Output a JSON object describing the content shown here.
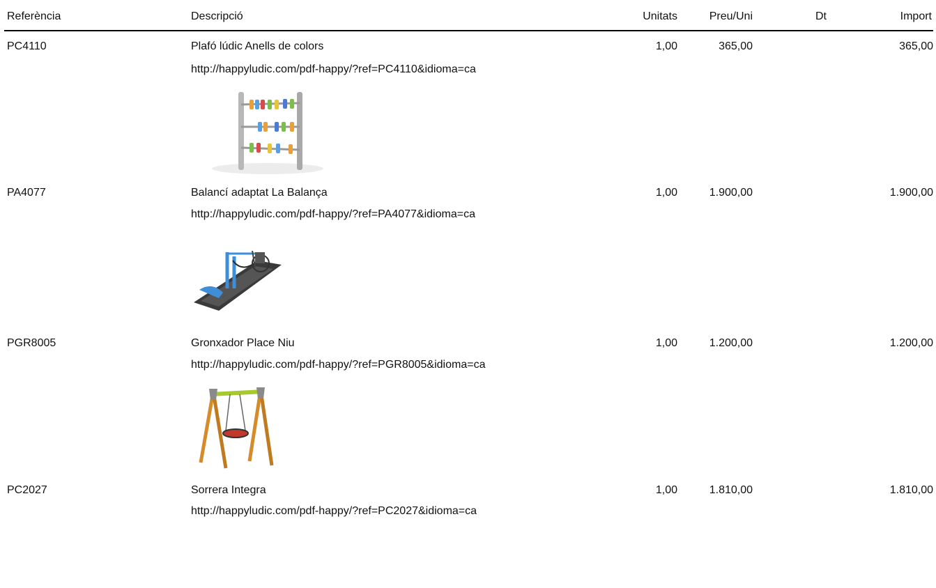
{
  "headers": {
    "reference": "Referència",
    "description": "Descripció",
    "units": "Unitats",
    "unit_price": "Preu/Uni",
    "discount": "Dt",
    "amount": "Import"
  },
  "rows": [
    {
      "reference": "PC4110",
      "description": "Plafó lúdic Anells de colors",
      "url": "http://happyludic.com/pdf-happy/?ref=PC4110&idioma=ca",
      "units": "1,00",
      "unit_price": "365,00",
      "discount": "",
      "amount": "365,00",
      "image": "abacus-rings-panel-image"
    },
    {
      "reference": "PA4077",
      "description": "Balancí adaptat La Balança",
      "url": "http://happyludic.com/pdf-happy/?ref=PA4077&idioma=ca",
      "units": "1,00",
      "unit_price": "1.900,00",
      "discount": "",
      "amount": "1.900,00",
      "image": "wheelchair-seesaw-image"
    },
    {
      "reference": "PGR8005",
      "description": "Gronxador Place Niu",
      "url": "http://happyludic.com/pdf-happy/?ref=PGR8005&idioma=ca",
      "units": "1,00",
      "unit_price": "1.200,00",
      "discount": "",
      "amount": "1.200,00",
      "image": "nest-swing-image"
    },
    {
      "reference": "PC2027",
      "description": "Sorrera Integra",
      "url": "http://happyludic.com/pdf-happy/?ref=PC2027&idioma=ca",
      "units": "1,00",
      "unit_price": "1.810,00",
      "discount": "",
      "amount": "1.810,00"
    }
  ]
}
